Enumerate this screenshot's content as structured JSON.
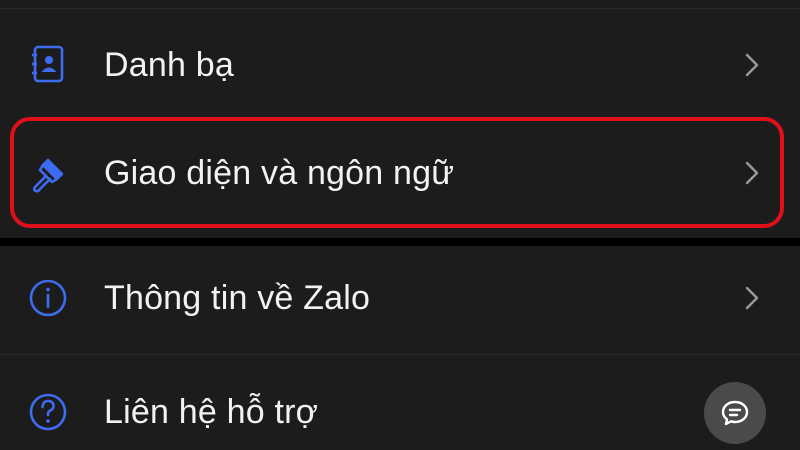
{
  "menu": {
    "items": [
      {
        "label": "Danh bạ",
        "icon": "contacts-book-icon"
      },
      {
        "label": "Giao diện và ngôn ngữ",
        "icon": "paint-brush-icon",
        "highlighted": true
      },
      {
        "label": "Thông tin về Zalo",
        "icon": "info-icon"
      },
      {
        "label": "Liên hệ hỗ trợ",
        "icon": "help-icon"
      }
    ]
  },
  "fab": {
    "icon": "chat-bubble-icon"
  },
  "colors": {
    "icon_accent": "#3d6cf0",
    "highlight_border": "#e0101a",
    "row_background": "#1c1c1c",
    "separator_background": "#000000",
    "text": "#f2f2f2"
  }
}
